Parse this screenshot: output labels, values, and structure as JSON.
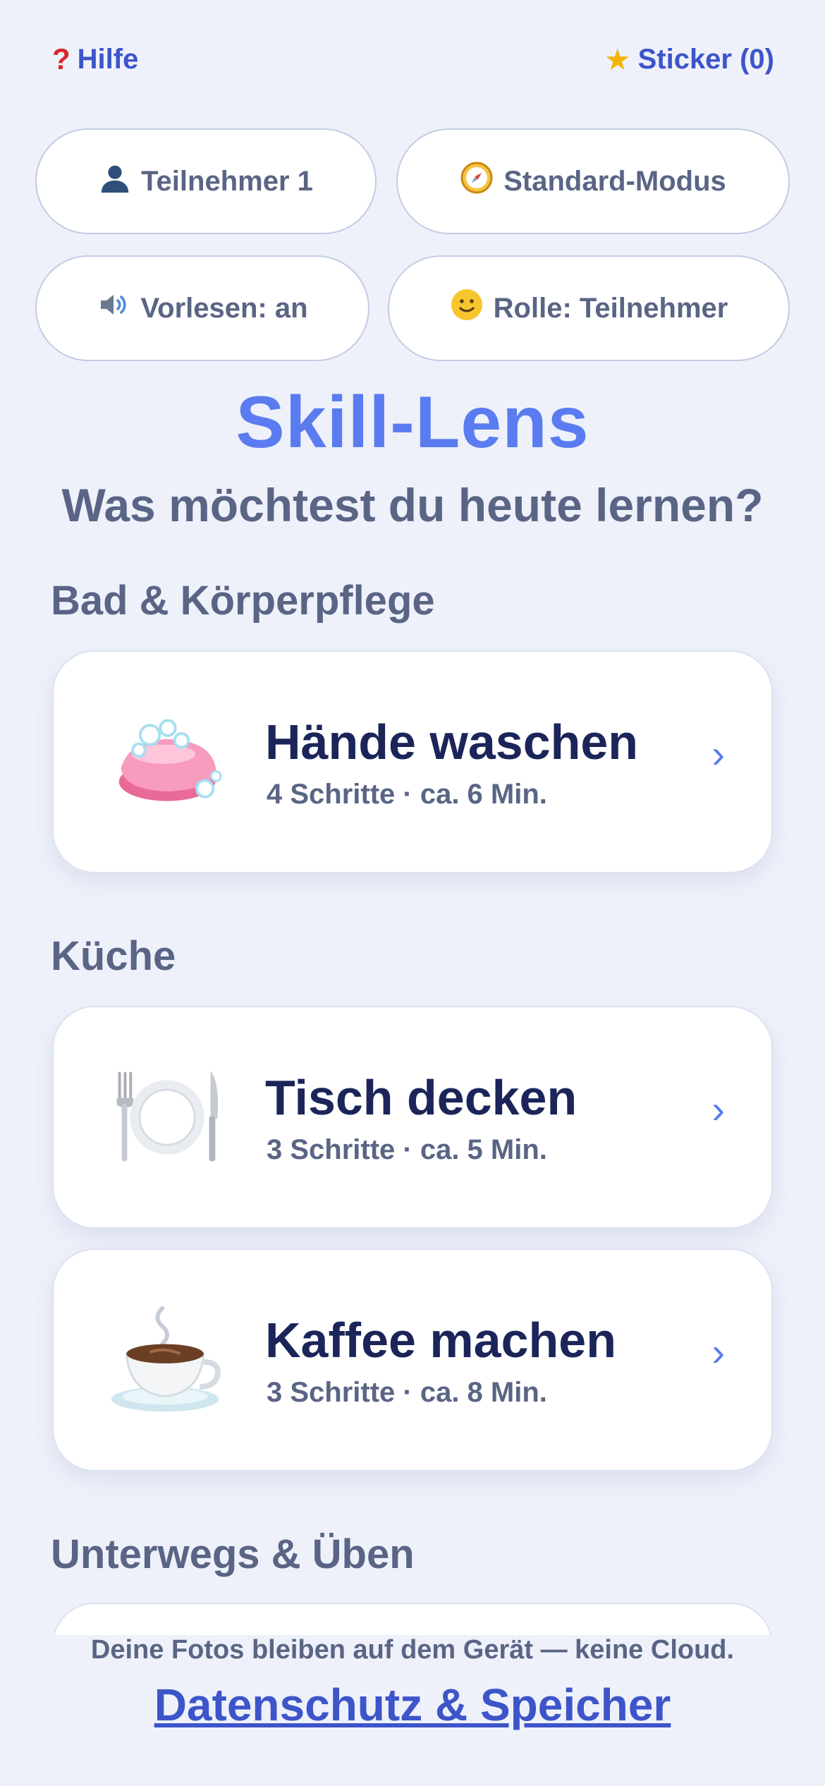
{
  "header": {
    "help_icon": "question-mark",
    "help_label": "Hilfe",
    "sticker_icon": "star",
    "sticker_label": "Sticker (0)"
  },
  "settings": {
    "participant": {
      "icon": "person-silhouette",
      "label": "Teilnehmer 1"
    },
    "mode": {
      "icon": "compass",
      "label": "Standard-Modus"
    },
    "read_aloud": {
      "icon": "speaker",
      "label": "Vorlesen: an"
    },
    "role": {
      "icon": "smiley-face",
      "label": "Rolle: Teilnehmer"
    }
  },
  "app_title": "Skill-Lens",
  "prompt": "Was möchtest du heute lernen?",
  "sections": [
    {
      "title": "Bad & Körperpflege",
      "skills": [
        {
          "name": "Hände waschen",
          "meta": "4 Schritte · ca. 6 Min.",
          "icon": "soap"
        }
      ]
    },
    {
      "title": "Küche",
      "skills": [
        {
          "name": "Tisch decken",
          "meta": "3 Schritte · ca. 5 Min.",
          "icon": "plate-with-cutlery"
        },
        {
          "name": "Kaffee machen",
          "meta": "3 Schritte · ca. 8 Min.",
          "icon": "hot-coffee"
        }
      ]
    },
    {
      "title": "Unterwegs & Üben",
      "skills": []
    }
  ],
  "chevron": "›",
  "footer": {
    "note": "Deine Fotos bleiben auf dem Gerät — keine Cloud.",
    "privacy_link": "Datenschutz & Speicher"
  },
  "colors": {
    "background": "#eef1fa",
    "accent": "#5b7cf0",
    "link": "#3d55c9",
    "heading_dark": "#1b2559",
    "text_muted": "#5a6585"
  }
}
